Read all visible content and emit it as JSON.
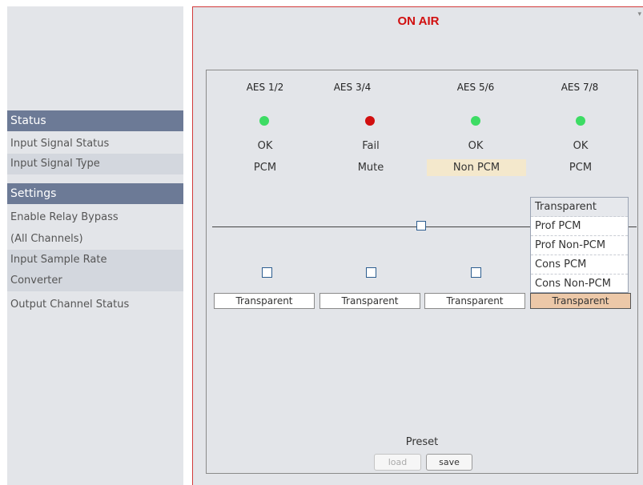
{
  "sidebar": {
    "status_header": "Status",
    "status_items": [
      "Input Signal Status",
      "Input Signal Type"
    ],
    "settings_header": "Settings",
    "settings_items": [
      "Enable Relay Bypass",
      "(All Channels)",
      "Input Sample Rate",
      "Converter",
      "Output Channel Status"
    ]
  },
  "main": {
    "title": "ON AIR",
    "channels": [
      {
        "name": "AES 1/2",
        "indicator": "green",
        "status": "OK",
        "type": "PCM",
        "select": "Transparent"
      },
      {
        "name": "AES 3/4",
        "indicator": "red",
        "status": "Fail",
        "type": "Mute",
        "select": "Transparent"
      },
      {
        "name": "AES 5/6",
        "indicator": "green",
        "status": "OK",
        "type": "Non PCM",
        "select": "Transparent"
      },
      {
        "name": "AES 7/8",
        "indicator": "green",
        "status": "OK",
        "type": "PCM",
        "select": "Transparent"
      }
    ],
    "dropdown_options": [
      "Transparent",
      "Prof PCM",
      "Prof Non-PCM",
      "Cons PCM",
      "Cons Non-PCM"
    ],
    "preset": {
      "label": "Preset",
      "load": "load",
      "save": "save"
    }
  },
  "colors": {
    "accent_red": "#d10f0f",
    "ok_green": "#3ddc64",
    "sidebar_header": "#6c7a96",
    "highlight": "#f4e8cc"
  }
}
